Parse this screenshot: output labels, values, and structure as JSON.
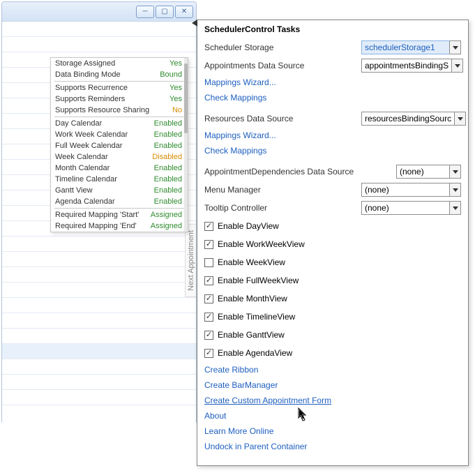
{
  "window": {
    "min": "─",
    "max": "▢",
    "close": "✕"
  },
  "verticalTab": "Next Appointment",
  "props": [
    [
      {
        "name": "Storage Assigned",
        "value": "Yes",
        "cls": "v-yes"
      },
      {
        "name": "Data Binding Mode",
        "value": "Bound",
        "cls": "v-bound"
      }
    ],
    [
      {
        "name": "Supports Recurrence",
        "value": "Yes",
        "cls": "v-yes"
      },
      {
        "name": "Supports Reminders",
        "value": "Yes",
        "cls": "v-yes"
      },
      {
        "name": "Supports Resource Sharing",
        "value": "No",
        "cls": "v-no"
      }
    ],
    [
      {
        "name": "Day Calendar",
        "value": "Enabled",
        "cls": "v-enabled"
      },
      {
        "name": "Work Week Calendar",
        "value": "Enabled",
        "cls": "v-enabled"
      },
      {
        "name": "Full Week Calendar",
        "value": "Enabled",
        "cls": "v-enabled"
      },
      {
        "name": "Week Calendar",
        "value": "Disabled",
        "cls": "v-disabled"
      },
      {
        "name": "Month Calendar",
        "value": "Enabled",
        "cls": "v-enabled"
      },
      {
        "name": "Timeline Calendar",
        "value": "Enabled",
        "cls": "v-enabled"
      },
      {
        "name": "Gantt View",
        "value": "Enabled",
        "cls": "v-enabled"
      },
      {
        "name": "Agenda Calendar",
        "value": "Enabled",
        "cls": "v-enabled"
      }
    ],
    [
      {
        "name": "Required Mapping 'Start'",
        "value": "Assigned",
        "cls": "v-assigned"
      },
      {
        "name": "Required Mapping 'End'",
        "value": "Assigned",
        "cls": "v-assigned"
      }
    ]
  ],
  "tasks": {
    "title": "SchedulerControl Tasks",
    "schedulerStorage": {
      "label": "Scheduler Storage",
      "value": "schedulerStorage1"
    },
    "appointmentsDS": {
      "label": "Appointments  Data Source",
      "value": "appointmentsBindingS"
    },
    "mappingsWizard": "Mappings Wizard...",
    "checkMappings": "Check Mappings",
    "resourcesDS": {
      "label": "Resources  Data Source",
      "value": "resourcesBindingSourc"
    },
    "apptDeps": {
      "label": "AppointmentDependencies  Data Source",
      "value": "(none)"
    },
    "menuManager": {
      "label": "Menu Manager",
      "value": "(none)"
    },
    "tooltipController": {
      "label": "Tooltip Controller",
      "value": "(none)"
    },
    "checks": [
      {
        "label": "Enable DayView",
        "checked": true
      },
      {
        "label": "Enable WorkWeekView",
        "checked": true
      },
      {
        "label": "Enable WeekView",
        "checked": false
      },
      {
        "label": "Enable FullWeekView",
        "checked": true
      },
      {
        "label": "Enable MonthView",
        "checked": true
      },
      {
        "label": "Enable TimelineView",
        "checked": true
      },
      {
        "label": "Enable GanttView",
        "checked": true
      },
      {
        "label": "Enable AgendaView",
        "checked": true
      }
    ],
    "links": {
      "createRibbon": "Create Ribbon",
      "createBarManager": "Create BarManager",
      "createCustomForm": "Create Custom Appointment Form",
      "about": "About",
      "learnMore": "Learn More Online",
      "undock": "Undock in Parent Container"
    }
  }
}
